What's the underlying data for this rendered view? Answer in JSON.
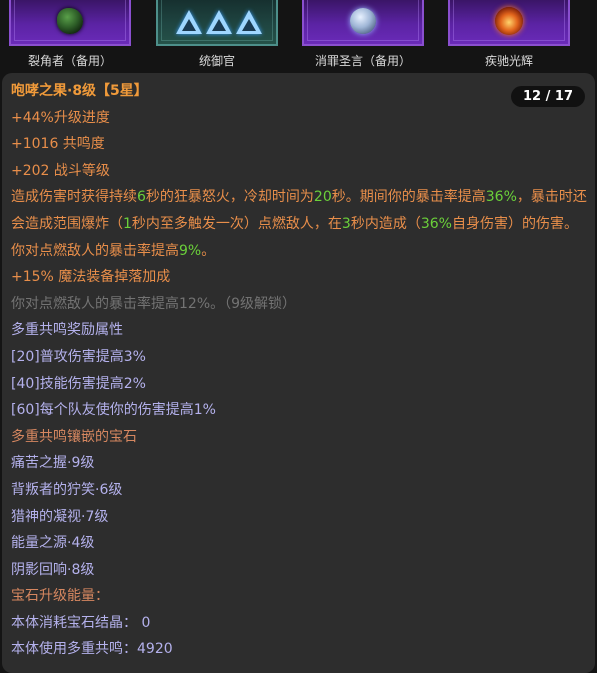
{
  "gems": [
    {
      "label": "裂角者（备用）",
      "icon": "green-beetle-icon"
    },
    {
      "label": "统御官",
      "icon": "blue-triangles-icon"
    },
    {
      "label": "消罪圣言（备用）",
      "icon": "white-orb-icon"
    },
    {
      "label": "疾驰光辉",
      "icon": "fiery-gem-icon"
    }
  ],
  "tooltip": {
    "title": "咆哮之果·8级【5星】",
    "page_indicator": "12 / 17",
    "stats": [
      {
        "value": "+44%",
        "label": "升级进度"
      },
      {
        "value": "+1016",
        "label": " 共鸣度"
      },
      {
        "value": "+202",
        "label": " 战斗等级"
      }
    ],
    "description": {
      "s1": "造成伤害时获得持续",
      "n1": "6",
      "s2": "秒的狂暴怒火，冷却时间为",
      "n2": "20",
      "s3": "秒。期间你的暴击率提高",
      "n3": "36%",
      "s4": "，暴击时还会造成范围爆炸（",
      "n4": "1",
      "s5": "秒内至多触发一次）点燃敌人，在",
      "n5": "3",
      "s6": "秒内造成（",
      "n6": "36%",
      "s7": "自身伤害）的伤害。你对点燃敌人的暴击率提高",
      "n7": "9%",
      "s8": "。"
    },
    "magic_find": {
      "value": "+15%",
      "label": " 魔法装备掉落加成"
    },
    "locked_line": "你对点燃敌人的暴击率提高12%。（9级解锁）",
    "resonance_rewards_header": "多重共鸣奖励属性",
    "resonance_rewards": [
      "[20]普攻伤害提高3%",
      "[40]技能伤害提高2%",
      "[60]每个队友使你的伤害提高1%"
    ],
    "socketed_gems_header": "多重共鸣镶嵌的宝石",
    "socketed_gems": [
      "痛苦之握·9级",
      "背叛者的狞笑·6级",
      "猎神的凝视·7级",
      "能量之源·4级",
      "阴影回响·8级"
    ],
    "upgrade_energy_header": "宝石升级能量：",
    "upgrade_energy": [
      {
        "label": "本体消耗宝石结晶：",
        "value": "0"
      },
      {
        "label": "本体使用多重共鸣：",
        "value": "4920"
      }
    ]
  },
  "colors": {
    "title": "#f09a3a",
    "highlight_green": "#6bd03a",
    "stat_orange": "#e88e4a",
    "locked_gray": "#737373",
    "bonus_lavender": "#b4b1ec",
    "header_brown": "#d68760",
    "panel_bg": "#2d2d2d",
    "gem_frame_purple": "#8a4fcf"
  }
}
